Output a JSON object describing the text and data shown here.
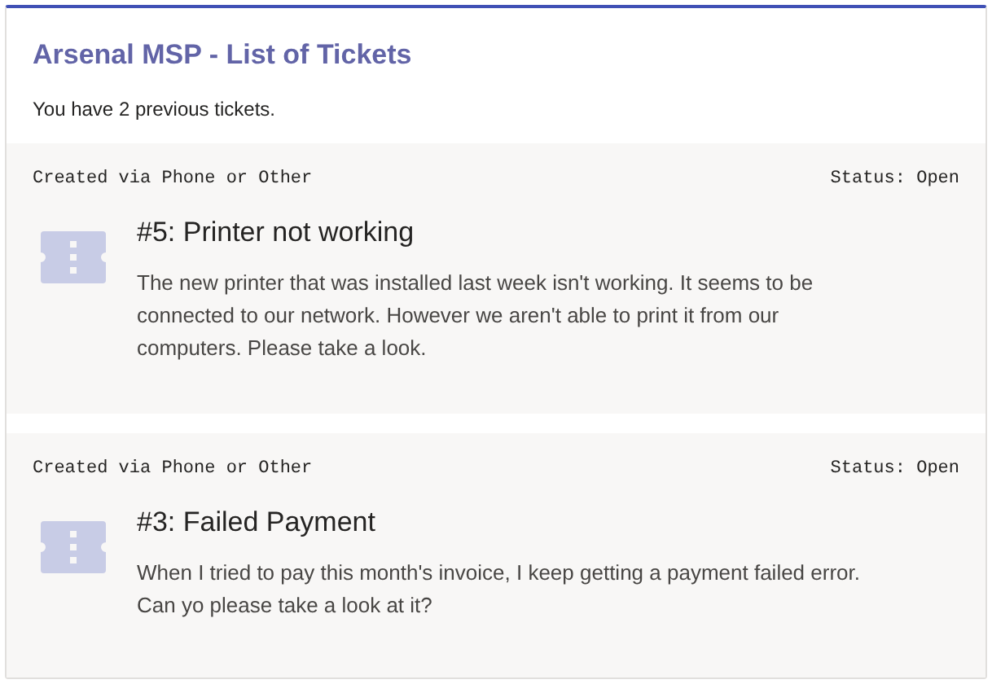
{
  "card": {
    "title": "Arsenal MSP - List of Tickets",
    "subtitle": "You have 2 previous tickets."
  },
  "tickets": [
    {
      "source": "Created via Phone or Other",
      "status": "Status: Open",
      "title": "#5: Printer not working",
      "description": "The new printer that was installed last week isn't working. It seems to be connected to our network. However we aren't able to print it from our computers. Please take a look."
    },
    {
      "source": "Created via Phone or Other",
      "status": "Status: Open",
      "title": "#3: Failed Payment",
      "description": "When I tried to pay this month's invoice, I keep getting a payment failed error. Can yo please take a look at it?"
    }
  ]
}
